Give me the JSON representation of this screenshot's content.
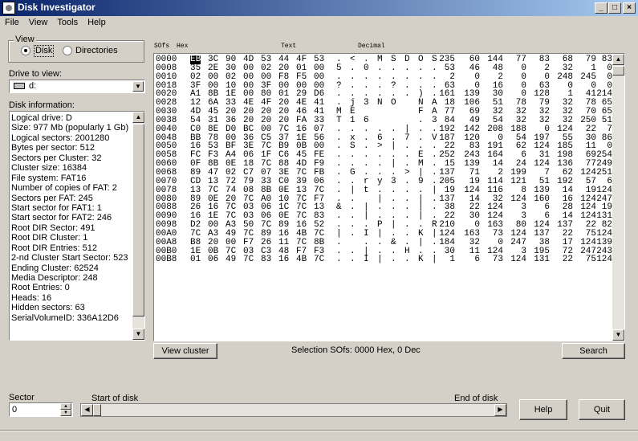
{
  "window": {
    "title": "Disk Investigator",
    "minimize": "_",
    "maximize": "□",
    "close": "×"
  },
  "menu": [
    "File",
    "View",
    "Tools",
    "Help"
  ],
  "view_group": {
    "label": "View",
    "disk": "Disk",
    "directories": "Directories",
    "selected": "Disk"
  },
  "drive": {
    "label": "Drive to view:",
    "value": "d:"
  },
  "disk_info": {
    "label": "Disk information:",
    "lines": [
      "Logical drive: D",
      "Size: 977 Mb (popularly 1 Gb)",
      "Logical sectors: 2001280",
      "Bytes per sector: 512",
      "Sectors per Cluster: 32",
      "Cluster size: 16384",
      "File system: FAT16",
      "Number of copies of FAT: 2",
      "Sectors per FAT: 245",
      "Start sector for FAT1: 1",
      "Start sector for FAT2: 246",
      "Root DIR Sector: 491",
      "Root DIR Cluster: 1",
      "Root DIR Entries: 512",
      "2-nd Cluster Start Sector: 523",
      "Ending Cluster: 62524",
      "Media Descriptor: 248",
      "Root Entries: 0",
      "Heads: 16",
      "Hidden sectors: 63",
      "SerialVolumeID: 336A12D6"
    ]
  },
  "hex_view": {
    "headers": {
      "sofs": "SOfs",
      "hex": "Hex",
      "text": "Text",
      "decimal": "Decimal"
    },
    "selected_byte": "EB",
    "rows": [
      {
        "off": "0000",
        "hex": [
          "EB",
          "3C",
          "90",
          "4D",
          "53",
          "44",
          "4F",
          "53"
        ],
        "txt": [
          ".",
          "<",
          ".",
          "M",
          "S",
          "D",
          "O",
          "S"
        ],
        "dec": [
          "235",
          "60",
          "144",
          "77",
          "83",
          "68",
          "79",
          "83"
        ]
      },
      {
        "off": "0008",
        "hex": [
          "35",
          "2E",
          "30",
          "00",
          "02",
          "20",
          "01",
          "00"
        ],
        "txt": [
          "5",
          ".",
          "0",
          ".",
          ".",
          ".",
          ".",
          "."
        ],
        "dec": [
          "53",
          "46",
          "48",
          "0",
          "2",
          "32",
          "1",
          "0"
        ]
      },
      {
        "off": "0010",
        "hex": [
          "02",
          "00",
          "02",
          "00",
          "00",
          "F8",
          "F5",
          "00"
        ],
        "txt": [
          ".",
          ".",
          ".",
          ".",
          ".",
          ".",
          ".",
          "."
        ],
        "dec": [
          "2",
          "0",
          "2",
          "0",
          "0",
          "248",
          "245",
          "0"
        ]
      },
      {
        "off": "0018",
        "hex": [
          "3F",
          "00",
          "10",
          "00",
          "3F",
          "00",
          "00",
          "00"
        ],
        "txt": [
          "?",
          ".",
          ".",
          ".",
          "?",
          ".",
          ".",
          "."
        ],
        "dec": [
          "63",
          "0",
          "16",
          "0",
          "63",
          "0",
          "0",
          "0"
        ]
      },
      {
        "off": "0020",
        "hex": [
          "A1",
          "8B",
          "1E",
          "00",
          "80",
          "01",
          "29",
          "D6"
        ],
        "txt": [
          ".",
          ".",
          ".",
          ".",
          ".",
          ".",
          ")",
          "."
        ],
        "dec": [
          "161",
          "139",
          "30",
          "0",
          "128",
          "1",
          "41",
          "214"
        ]
      },
      {
        "off": "0028",
        "hex": [
          "12",
          "6A",
          "33",
          "4E",
          "4F",
          "20",
          "4E",
          "41"
        ],
        "txt": [
          ".",
          "j",
          "3",
          "N",
          "O",
          " ",
          "N",
          "A"
        ],
        "dec": [
          "18",
          "106",
          "51",
          "78",
          "79",
          "32",
          "78",
          "65"
        ]
      },
      {
        "off": "0030",
        "hex": [
          "4D",
          "45",
          "20",
          "20",
          "20",
          "20",
          "46",
          "41"
        ],
        "txt": [
          "M",
          "E",
          " ",
          " ",
          " ",
          " ",
          "F",
          "A"
        ],
        "dec": [
          "77",
          "69",
          "32",
          "32",
          "32",
          "32",
          "70",
          "65"
        ]
      },
      {
        "off": "0038",
        "hex": [
          "54",
          "31",
          "36",
          "20",
          "20",
          "20",
          "FA",
          "33"
        ],
        "txt": [
          "T",
          "1",
          "6",
          " ",
          " ",
          " ",
          ".",
          "3"
        ],
        "dec": [
          "84",
          "49",
          "54",
          "32",
          "32",
          "32",
          "250",
          "51"
        ]
      },
      {
        "off": "0040",
        "hex": [
          "C0",
          "8E",
          "D0",
          "BC",
          "00",
          "7C",
          "16",
          "07"
        ],
        "txt": [
          ".",
          ".",
          ".",
          ".",
          ".",
          "|",
          ".",
          "."
        ],
        "dec": [
          "192",
          "142",
          "208",
          "188",
          "0",
          "124",
          "22",
          "7"
        ]
      },
      {
        "off": "0048",
        "hex": [
          "BB",
          "78",
          "00",
          "36",
          "C5",
          "37",
          "1E",
          "56"
        ],
        "txt": [
          ".",
          "x",
          ".",
          "6",
          ".",
          "7",
          ".",
          "V"
        ],
        "dec": [
          "187",
          "120",
          "0",
          "54",
          "197",
          "55",
          "30",
          "86"
        ]
      },
      {
        "off": "0050",
        "hex": [
          "16",
          "53",
          "BF",
          "3E",
          "7C",
          "B9",
          "0B",
          "00"
        ],
        "txt": [
          ".",
          "S",
          ".",
          ">",
          "|",
          ".",
          ".",
          "."
        ],
        "dec": [
          "22",
          "83",
          "191",
          "62",
          "124",
          "185",
          "11",
          "0"
        ]
      },
      {
        "off": "0058",
        "hex": [
          "FC",
          "F3",
          "A4",
          "06",
          "1F",
          "C6",
          "45",
          "FE"
        ],
        "txt": [
          ".",
          ".",
          ".",
          ".",
          ".",
          ".",
          "E",
          "."
        ],
        "dec": [
          "252",
          "243",
          "164",
          "6",
          "31",
          "198",
          "69",
          "254"
        ]
      },
      {
        "off": "0060",
        "hex": [
          "0F",
          "8B",
          "0E",
          "18",
          "7C",
          "88",
          "4D",
          "F9"
        ],
        "txt": [
          ".",
          ".",
          ".",
          ".",
          "|",
          ".",
          "M",
          "."
        ],
        "dec": [
          "15",
          "139",
          "14",
          "24",
          "124",
          "136",
          "77",
          "249"
        ]
      },
      {
        "off": "0068",
        "hex": [
          "89",
          "47",
          "02",
          "C7",
          "07",
          "3E",
          "7C",
          "FB"
        ],
        "txt": [
          ".",
          "G",
          ".",
          ".",
          ".",
          ">",
          "|",
          "."
        ],
        "dec": [
          "137",
          "71",
          "2",
          "199",
          "7",
          "62",
          "124",
          "251"
        ]
      },
      {
        "off": "0070",
        "hex": [
          "CD",
          "13",
          "72",
          "79",
          "33",
          "C0",
          "39",
          "06"
        ],
        "txt": [
          ".",
          ".",
          "r",
          "y",
          "3",
          ".",
          "9",
          "."
        ],
        "dec": [
          "205",
          "19",
          "114",
          "121",
          "51",
          "192",
          "57",
          "6"
        ]
      },
      {
        "off": "0078",
        "hex": [
          "13",
          "7C",
          "74",
          "08",
          "8B",
          "0E",
          "13",
          "7C"
        ],
        "txt": [
          ".",
          "|",
          "t",
          ".",
          ".",
          ".",
          ".",
          "|"
        ],
        "dec": [
          "19",
          "124",
          "116",
          "8",
          "139",
          "14",
          "19",
          "124"
        ]
      },
      {
        "off": "0080",
        "hex": [
          "89",
          "0E",
          "20",
          "7C",
          "A0",
          "10",
          "7C",
          "F7"
        ],
        "txt": [
          ".",
          ".",
          " ",
          "|",
          ".",
          ".",
          "|",
          "."
        ],
        "dec": [
          "137",
          "14",
          "32",
          "124",
          "160",
          "16",
          "124",
          "247"
        ]
      },
      {
        "off": "0088",
        "hex": [
          "26",
          "16",
          "7C",
          "03",
          "06",
          "1C",
          "7C",
          "13"
        ],
        "txt": [
          "&",
          ".",
          "|",
          ".",
          ".",
          ".",
          "|",
          "."
        ],
        "dec": [
          "38",
          "22",
          "124",
          "3",
          "6",
          "28",
          "124",
          "19"
        ]
      },
      {
        "off": "0090",
        "hex": [
          "16",
          "1E",
          "7C",
          "03",
          "06",
          "0E",
          "7C",
          "83"
        ],
        "txt": [
          ".",
          ".",
          "|",
          ".",
          ".",
          ".",
          "|",
          "."
        ],
        "dec": [
          "22",
          "30",
          "124",
          "3",
          "6",
          "14",
          "124",
          "131"
        ]
      },
      {
        "off": "0098",
        "hex": [
          "D2",
          "00",
          "A3",
          "50",
          "7C",
          "89",
          "16",
          "52"
        ],
        "txt": [
          ".",
          ".",
          ".",
          "P",
          "|",
          ".",
          ".",
          "R"
        ],
        "dec": [
          "210",
          "0",
          "163",
          "80",
          "124",
          "137",
          "22",
          "82"
        ]
      },
      {
        "off": "00A0",
        "hex": [
          "7C",
          "A3",
          "49",
          "7C",
          "89",
          "16",
          "4B",
          "7C"
        ],
        "txt": [
          "|",
          ".",
          "I",
          "|",
          ".",
          ".",
          "K",
          "|"
        ],
        "dec": [
          "124",
          "163",
          "73",
          "124",
          "137",
          "22",
          "75",
          "124"
        ]
      },
      {
        "off": "00A8",
        "hex": [
          "B8",
          "20",
          "00",
          "F7",
          "26",
          "11",
          "7C",
          "8B"
        ],
        "txt": [
          ".",
          " ",
          ".",
          ".",
          "&",
          ".",
          "|",
          "."
        ],
        "dec": [
          "184",
          "32",
          "0",
          "247",
          "38",
          "17",
          "124",
          "139"
        ]
      },
      {
        "off": "00B0",
        "hex": [
          "1E",
          "0B",
          "7C",
          "03",
          "C3",
          "48",
          "F7",
          "F3"
        ],
        "txt": [
          ".",
          ".",
          "|",
          ".",
          ".",
          "H",
          ".",
          "."
        ],
        "dec": [
          "30",
          "11",
          "124",
          "3",
          "195",
          "72",
          "247",
          "243"
        ]
      },
      {
        "off": "00B8",
        "hex": [
          "01",
          "06",
          "49",
          "7C",
          "83",
          "16",
          "4B",
          "7C"
        ],
        "txt": [
          ".",
          ".",
          "I",
          "|",
          ".",
          ".",
          "K",
          "|"
        ],
        "dec": [
          "1",
          "6",
          "73",
          "124",
          "131",
          "22",
          "75",
          "124"
        ]
      }
    ]
  },
  "buttons": {
    "view_cluster": "View cluster",
    "search": "Search",
    "help": "Help",
    "quit": "Quit"
  },
  "selection_status": "Selection SOfs: 0000 Hex,  0 Dec",
  "sector": {
    "label": "Sector",
    "value": "0"
  },
  "slider": {
    "start_label": "Start of disk",
    "end_label": "End of disk",
    "position": 0
  }
}
